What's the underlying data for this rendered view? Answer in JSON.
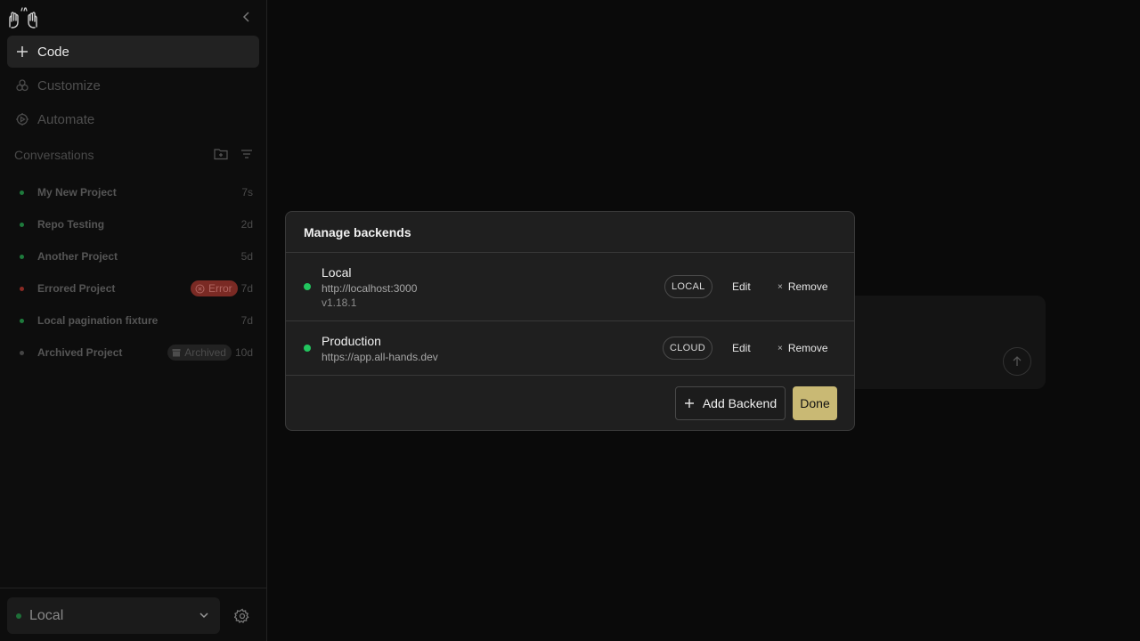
{
  "sidebar": {
    "nav": {
      "code_label": "Code",
      "customize_label": "Customize",
      "automate_label": "Automate"
    },
    "conversations_header": "Conversations",
    "conversations": [
      {
        "title": "My New Project",
        "age": "7s",
        "status_color": "#1e7a3c"
      },
      {
        "title": "Repo Testing",
        "age": "2d",
        "status_color": "#1e7a3c"
      },
      {
        "title": "Another Project",
        "age": "5d",
        "status_color": "#1e7a3c"
      },
      {
        "title": "Errored Project",
        "age": "7d",
        "status_color": "#8a2a24",
        "badge": "Error"
      },
      {
        "title": "Local pagination fixture",
        "age": "7d",
        "status_color": "#1e7a3c"
      },
      {
        "title": "Archived Project",
        "age": "10d",
        "status_color": "#444444",
        "badge": "Archived"
      }
    ],
    "footer": {
      "backend_label": "Local"
    }
  },
  "modal": {
    "title": "Manage backends",
    "backends": [
      {
        "name": "Local",
        "url": "http://localhost:3000",
        "version": "v1.18.1",
        "type": "LOCAL",
        "edit_label": "Edit",
        "remove_label": "Remove"
      },
      {
        "name": "Production",
        "url": "https://app.all-hands.dev",
        "type": "CLOUD",
        "edit_label": "Edit",
        "remove_label": "Remove"
      }
    ],
    "add_label": "Add Backend",
    "done_label": "Done"
  },
  "colors": {
    "accent": "#c9b974",
    "status_ok": "#22c55e",
    "error": "#7a2a24"
  }
}
